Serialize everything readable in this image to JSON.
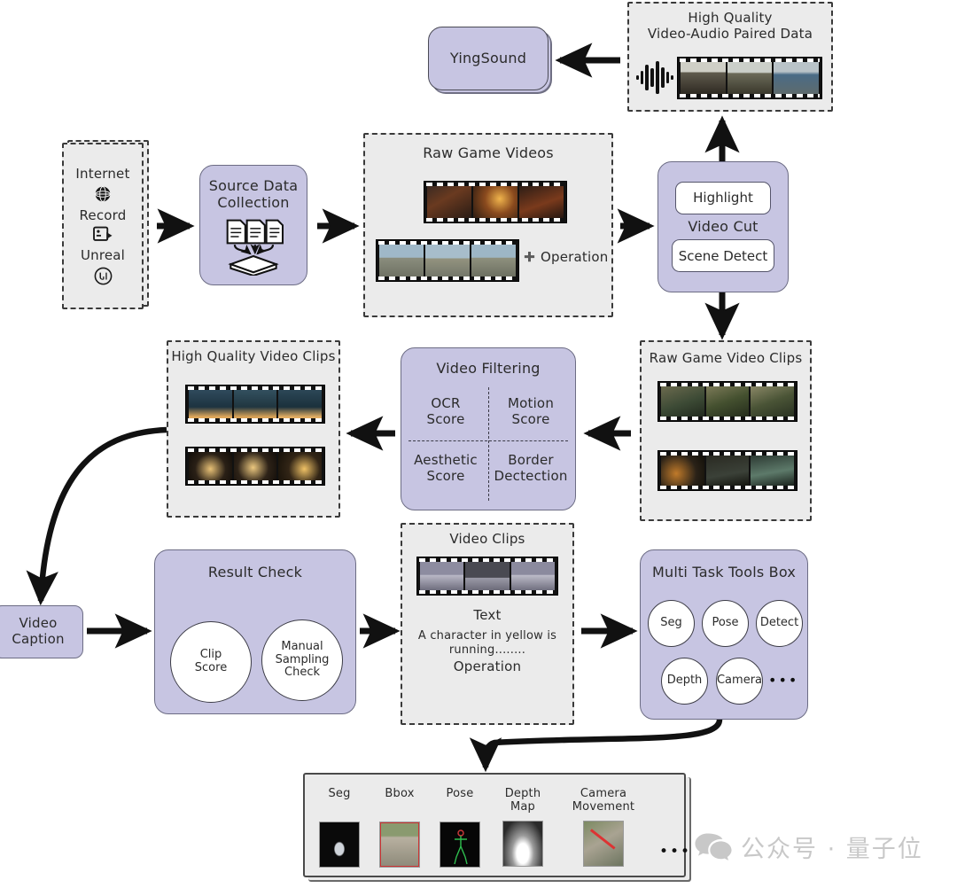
{
  "colors": {
    "purple": "#c7c5e2",
    "panel": "#ebebeb",
    "stroke": "#3a3a3a",
    "watermark": "#c8c8c8"
  },
  "nodes": {
    "sources": {
      "name": "Source Types",
      "items": [
        {
          "label": "Internet",
          "icon": "globe-icon"
        },
        {
          "label": "Record",
          "icon": "screen-record-icon"
        },
        {
          "label": "Unreal",
          "icon": "unreal-engine-icon"
        }
      ]
    },
    "source_data_collection": {
      "title": "Source Data",
      "title2": "Collection",
      "icon": "documents-to-stack-icon"
    },
    "raw_game_videos": {
      "title": "Raw Game Videos",
      "operation_label": "Operation",
      "operation_icon": "plus-icon"
    },
    "video_cut": {
      "title": "Video Cut",
      "top_label": "Highlight",
      "bottom_label": "Scene Detect"
    },
    "high_quality_pair": {
      "title_line1": "High Quality",
      "title_line2": "Video-Audio Paired Data",
      "audio_icon": "audio-waveform-icon"
    },
    "yingsound": {
      "label": "YingSound"
    },
    "raw_game_video_clips": {
      "title": "Raw Game Video Clips"
    },
    "video_filtering": {
      "title": "Video Filtering",
      "quadrants": [
        {
          "line1": "OCR",
          "line2": "Score"
        },
        {
          "line1": "Motion",
          "line2": "Score"
        },
        {
          "line1": "Aesthetic",
          "line2": "Score"
        },
        {
          "line1": "Border",
          "line2": "Dectection"
        }
      ]
    },
    "high_quality_video_clips": {
      "title": "High Quality Video Clips"
    },
    "video_caption": {
      "line1": "Video",
      "line2": "Caption"
    },
    "result_check": {
      "title": "Result Check",
      "circles": [
        {
          "lines": [
            "Clip",
            "Score"
          ]
        },
        {
          "lines": [
            "Manual",
            "Sampling",
            "Check"
          ]
        }
      ]
    },
    "video_clips": {
      "title": "Video Clips",
      "text_heading": "Text",
      "text_body": "A character in yellow  is running........",
      "operation_label": "Operation"
    },
    "multi_task_tools_box": {
      "title": "Multi Task Tools Box",
      "tools_row1": [
        "Seg",
        "Pose",
        "Detect"
      ],
      "tools_row2": [
        "Depth",
        "Camera"
      ],
      "more": "•••"
    },
    "results_panel": {
      "columns": [
        {
          "lines": [
            "Seg"
          ],
          "thumb": "segmentation-thumb"
        },
        {
          "lines": [
            "Bbox"
          ],
          "thumb": "bbox-thumb"
        },
        {
          "lines": [
            "Pose"
          ],
          "thumb": "pose-thumb"
        },
        {
          "lines": [
            "Depth",
            "Map"
          ],
          "thumb": "depth-map-thumb"
        },
        {
          "lines": [
            "Camera",
            "Movement"
          ],
          "thumb": "camera-movement-thumb"
        }
      ],
      "more": "•••"
    }
  },
  "watermark": {
    "icon": "wechat-icon",
    "text": "公众号 · 量子位"
  }
}
